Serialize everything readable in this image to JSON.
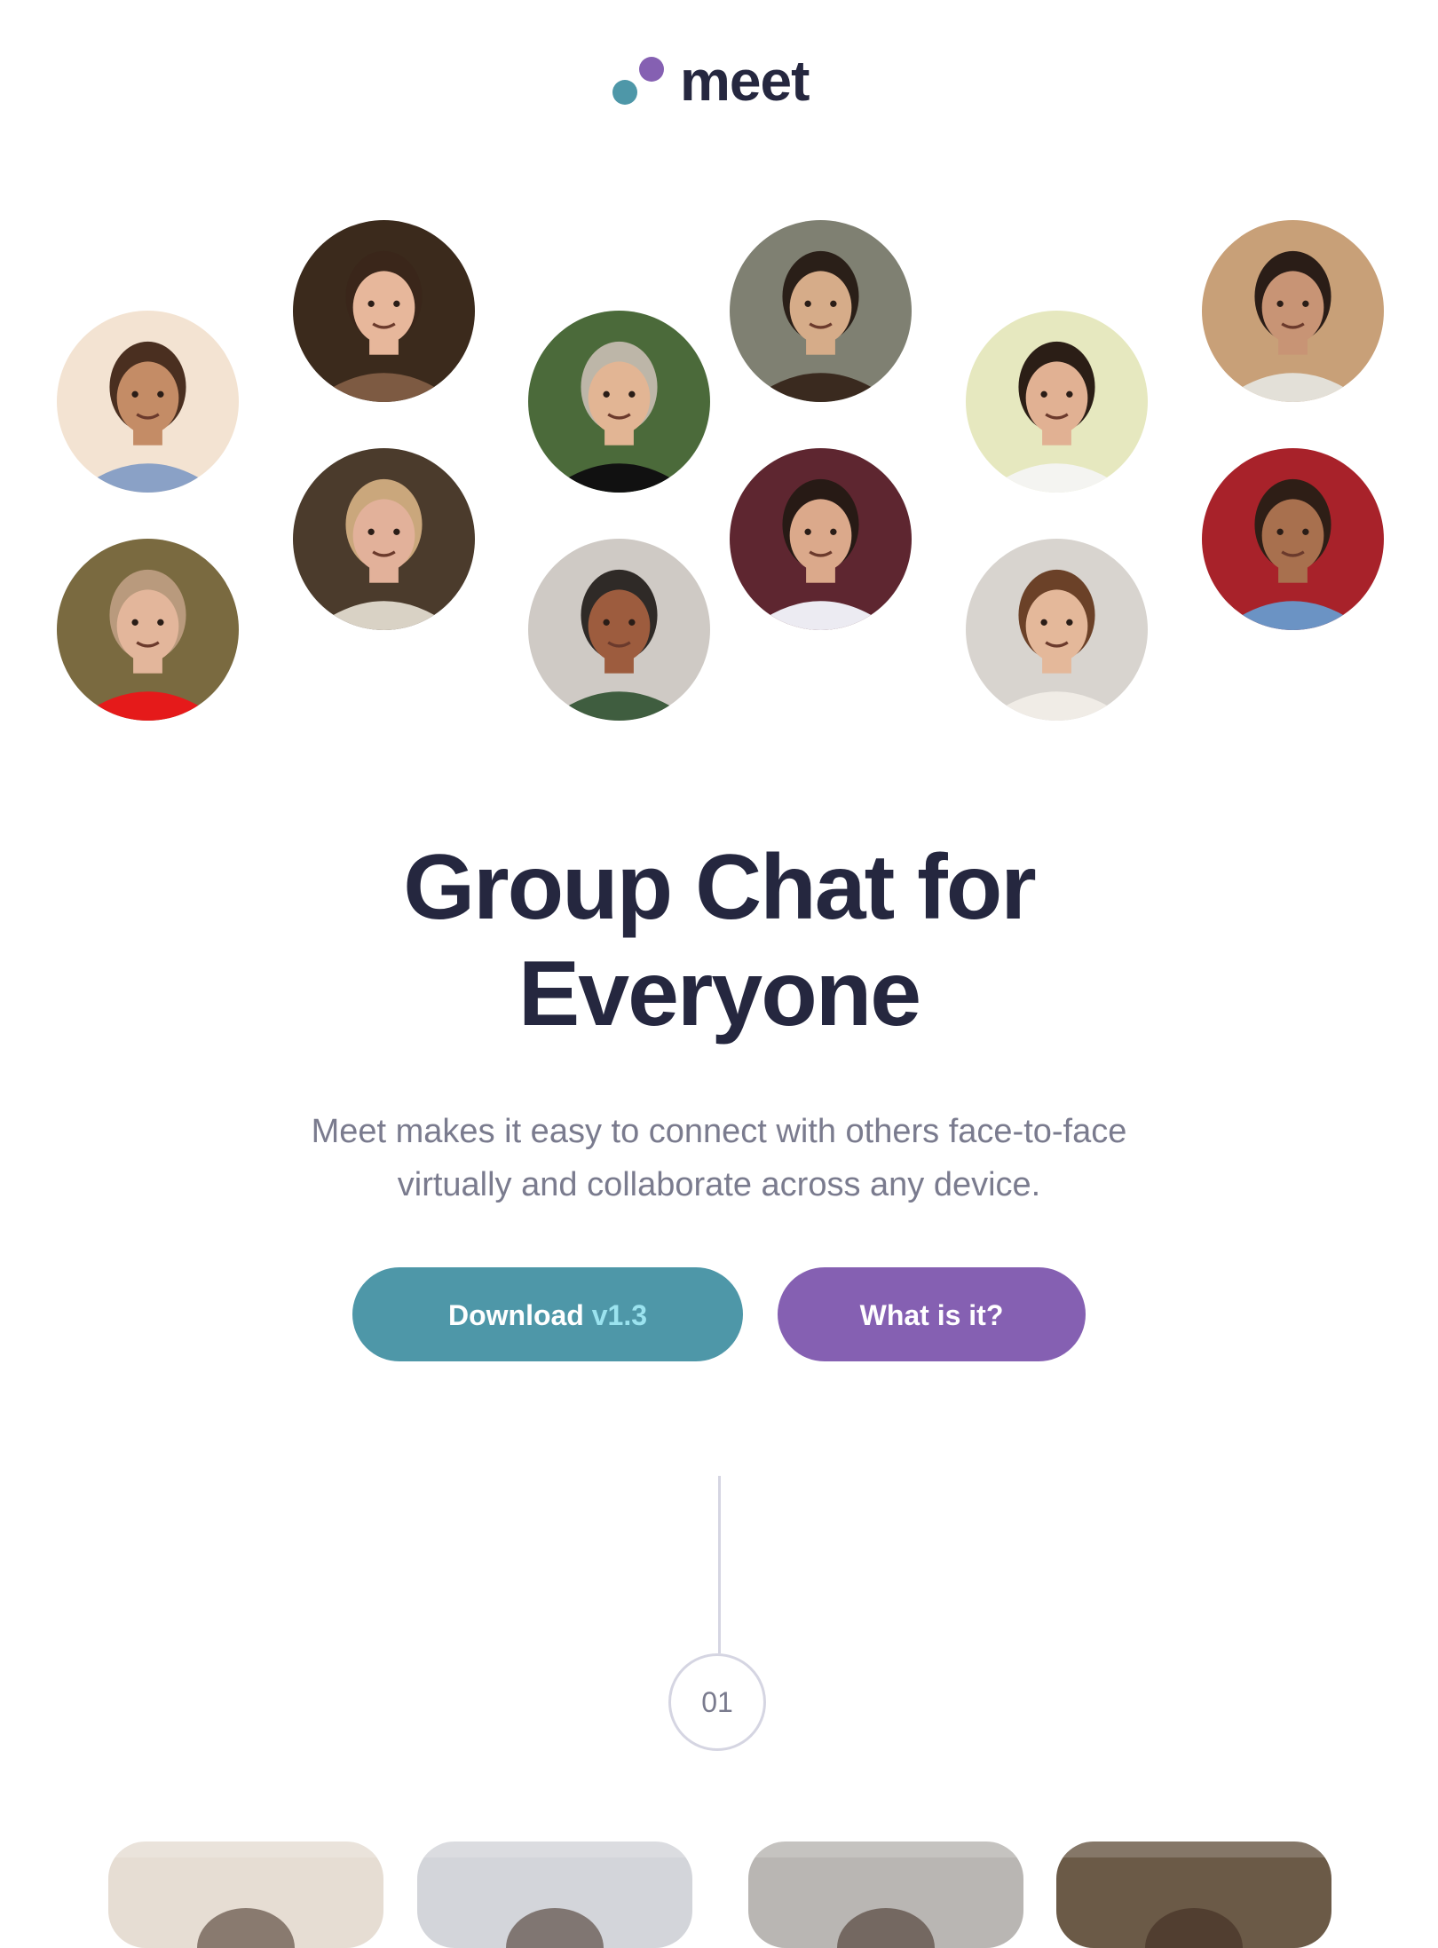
{
  "brand": {
    "name": "meet",
    "teal": "#4e97a8",
    "purple": "#8560b2",
    "dark": "#25273f"
  },
  "avatars": [
    {
      "name": "avatar-1",
      "bg": "#f3e3d2",
      "skin": "#c48c66",
      "hair": "#4a2f20",
      "shirt": "#8aa1c6"
    },
    {
      "name": "avatar-2",
      "bg": "#3b2a1c",
      "skin": "#e7b79b",
      "hair": "#3a261a",
      "shirt": "#7d5a42"
    },
    {
      "name": "avatar-3",
      "bg": "#4b6a3a",
      "skin": "#e2b594",
      "hair": "#bdb6a8",
      "shirt": "#111111"
    },
    {
      "name": "avatar-4",
      "bg": "#7f8072",
      "skin": "#d6ac89",
      "hair": "#2a1f18",
      "shirt": "#3a2a1f"
    },
    {
      "name": "avatar-5",
      "bg": "#e6e8bf",
      "skin": "#e1b193",
      "hair": "#2b1e16",
      "shirt": "#f4f4f1"
    },
    {
      "name": "avatar-6",
      "bg": "#c8a078",
      "skin": "#c89475",
      "hair": "#2a1d17",
      "shirt": "#e3e0d8"
    },
    {
      "name": "avatar-7",
      "bg": "#7a6a40",
      "skin": "#e3b69b",
      "hair": "#b99a7d",
      "shirt": "#e51a1a"
    },
    {
      "name": "avatar-8",
      "bg": "#4b3b2c",
      "skin": "#e2b19a",
      "hair": "#caa77c",
      "shirt": "#d9d2c5"
    },
    {
      "name": "avatar-9",
      "bg": "#cfcac5",
      "skin": "#9d5c3e",
      "hair": "#2f2a27",
      "shirt": "#3f5d3f"
    },
    {
      "name": "avatar-10",
      "bg": "#5e2630",
      "skin": "#dba98b",
      "hair": "#271a15",
      "shirt": "#ecebf2"
    },
    {
      "name": "avatar-11",
      "bg": "#d8d4cf",
      "skin": "#e4b89a",
      "hair": "#6b4128",
      "shirt": "#f0ece6"
    },
    {
      "name": "avatar-12",
      "bg": "#a8222a",
      "skin": "#a8704e",
      "hair": "#2e1e16",
      "shirt": "#6b93c4"
    }
  ],
  "hero": {
    "line1": "Group Chat for",
    "line2": "Everyone",
    "subtitle": "Meet makes it easy to connect with others face-to-face virtually and collaborate across any device."
  },
  "buttons": {
    "download_label": "Download",
    "download_version": "v1.3",
    "what_label": "What is it?"
  },
  "step": {
    "number": "01"
  },
  "cards": [
    {
      "name": "card-1",
      "bg": "#e6ddd3"
    },
    {
      "name": "card-2",
      "bg": "#d3d5da"
    },
    {
      "name": "card-3",
      "bg": "#b9b6b3"
    },
    {
      "name": "card-4",
      "bg": "#6b5a47"
    }
  ]
}
